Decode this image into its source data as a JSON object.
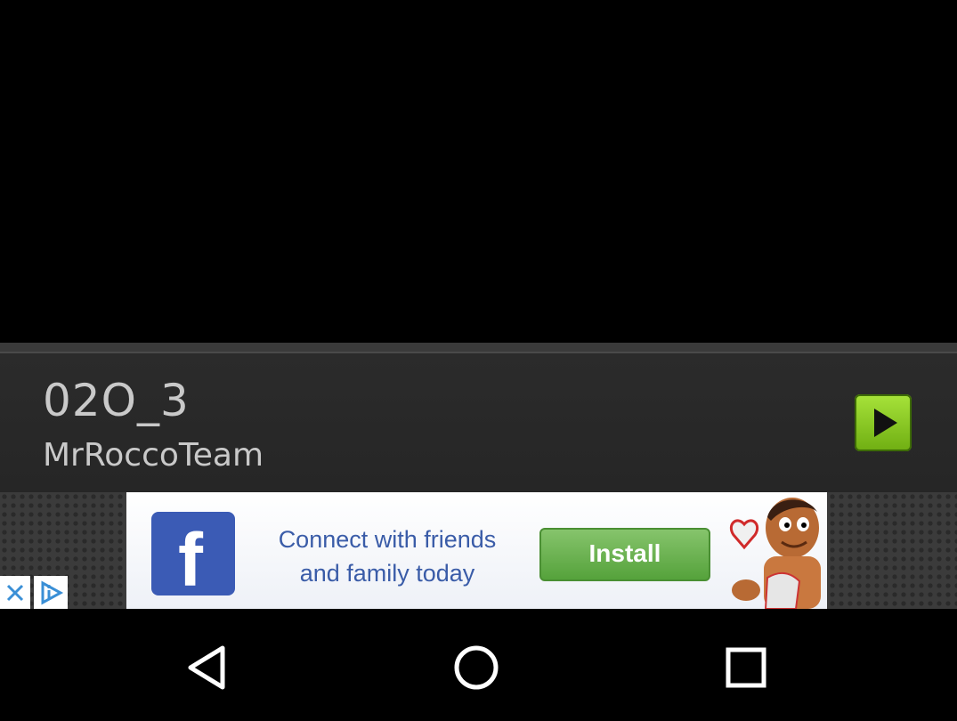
{
  "player": {
    "title": "02O_3",
    "artist": "MrRoccoTeam",
    "play_icon": "play-icon"
  },
  "ad": {
    "logo_letter": "f",
    "text": "Connect with friends and family today",
    "install_label": "Install",
    "close_icon": "close-icon",
    "info_icon": "adchoices-icon"
  },
  "navbar": {
    "back_icon": "back-icon",
    "home_icon": "home-icon",
    "recents_icon": "recents-icon"
  },
  "colors": {
    "play_green": "#8bcb22",
    "facebook_blue": "#3b5bb5",
    "install_green": "#6bb14e"
  }
}
